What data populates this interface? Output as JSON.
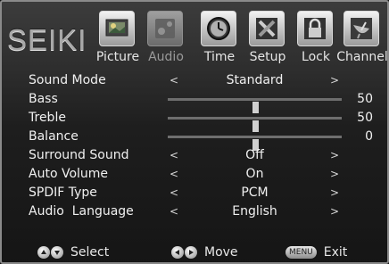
{
  "brand": "SEIKI",
  "tabs": [
    {
      "label": "Picture",
      "icon": "picture-icon",
      "active": false
    },
    {
      "label": "Audio",
      "icon": "audio-icon",
      "active": true
    },
    {
      "label": "Time",
      "icon": "clock-icon",
      "active": false
    },
    {
      "label": "Setup",
      "icon": "setup-tools-icon",
      "active": false
    },
    {
      "label": "Lock",
      "icon": "lock-icon",
      "active": false
    },
    {
      "label": "Channel",
      "icon": "satellite-dish-icon",
      "active": false
    }
  ],
  "menu": {
    "sound_mode": {
      "label": "Sound Mode",
      "value": "Standard"
    },
    "bass": {
      "label": "Bass",
      "value": "50",
      "level": 50
    },
    "treble": {
      "label": "Treble",
      "value": "50",
      "level": 50
    },
    "balance": {
      "label": "Balance",
      "value": "0",
      "level": 0
    },
    "surround": {
      "label": "Surround Sound",
      "value": "Off"
    },
    "auto_volume": {
      "label": "Auto Volume",
      "value": "On"
    },
    "spdif": {
      "label": "SPDIF Type",
      "value": "PCM"
    },
    "language": {
      "label": "Audio  Language",
      "value": "English"
    }
  },
  "arrows": {
    "left": "<",
    "right": ">"
  },
  "footer": {
    "select_label": "Select",
    "move_label": "Move",
    "menu_key": "MENU",
    "exit_label": "Exit"
  },
  "colors": {
    "text": "#f0f0f0",
    "inactive_tab": "#9a9a9a"
  }
}
